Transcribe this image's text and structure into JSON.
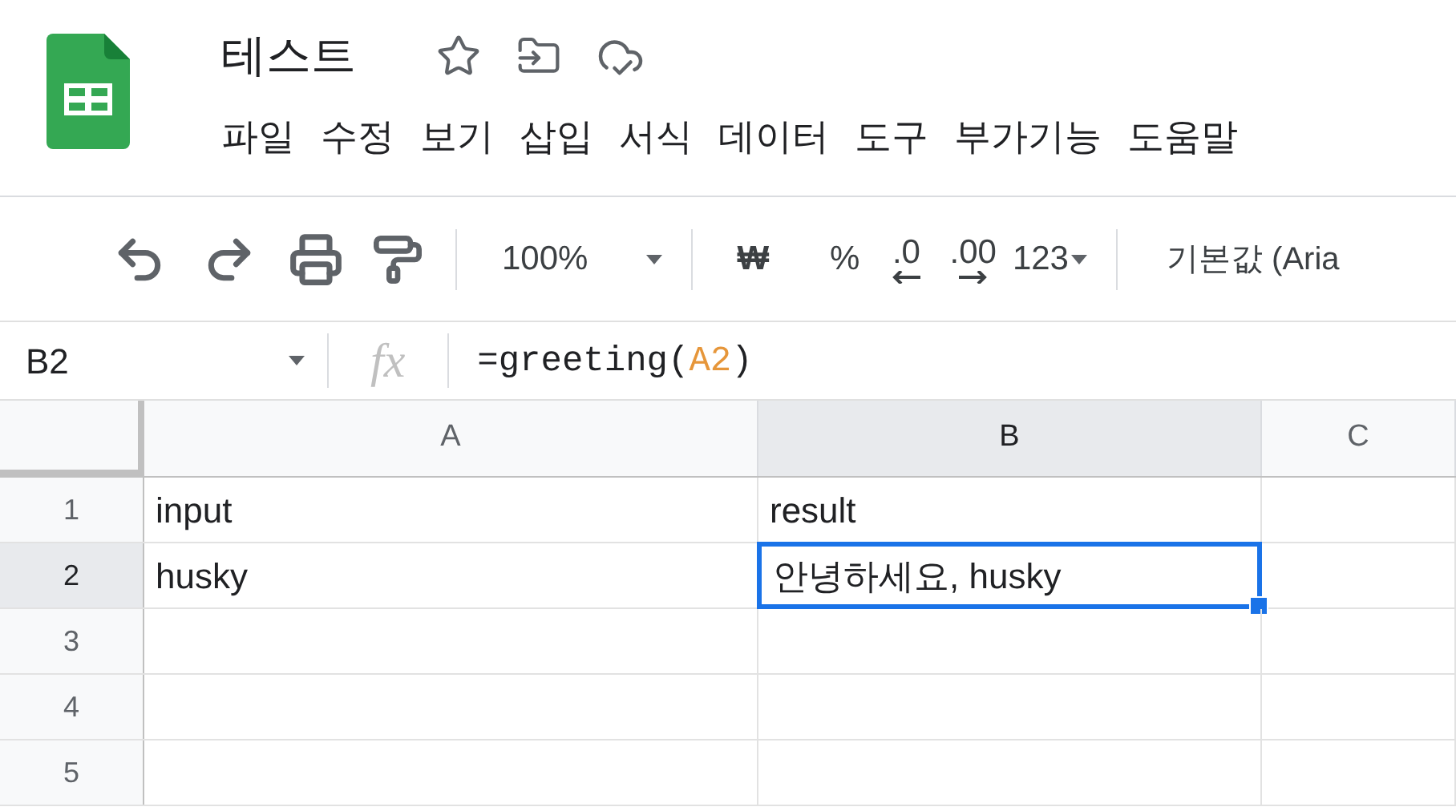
{
  "document": {
    "title": "테스트"
  },
  "menu": [
    "파일",
    "수정",
    "보기",
    "삽입",
    "서식",
    "데이터",
    "도구",
    "부가기능",
    "도움말"
  ],
  "toolbar": {
    "zoom": "100%",
    "currency": "₩",
    "percent": "%",
    "decrease_decimal": ".0",
    "increase_decimal": ".00",
    "number_format": "123",
    "font": "기본값 (Aria"
  },
  "formula_bar": {
    "cell_ref": "B2",
    "function_label": "fx",
    "prefix": "=greeting(",
    "reference": "A2",
    "suffix": ")"
  },
  "grid": {
    "columns": [
      {
        "label": "A",
        "selected": false
      },
      {
        "label": "B",
        "selected": true
      },
      {
        "label": "C",
        "selected": false
      }
    ],
    "rows": [
      {
        "label": "1",
        "selected": false,
        "cells": [
          {
            "text": "input",
            "selected": false
          },
          {
            "text": "result",
            "selected": false
          }
        ]
      },
      {
        "label": "2",
        "selected": true,
        "cells": [
          {
            "text": "husky",
            "selected": false
          },
          {
            "text": "안녕하세요, husky",
            "selected": true
          }
        ]
      },
      {
        "label": "3",
        "selected": false,
        "cells": []
      },
      {
        "label": "4",
        "selected": false,
        "cells": []
      },
      {
        "label": "5",
        "selected": false,
        "cells": []
      }
    ]
  }
}
